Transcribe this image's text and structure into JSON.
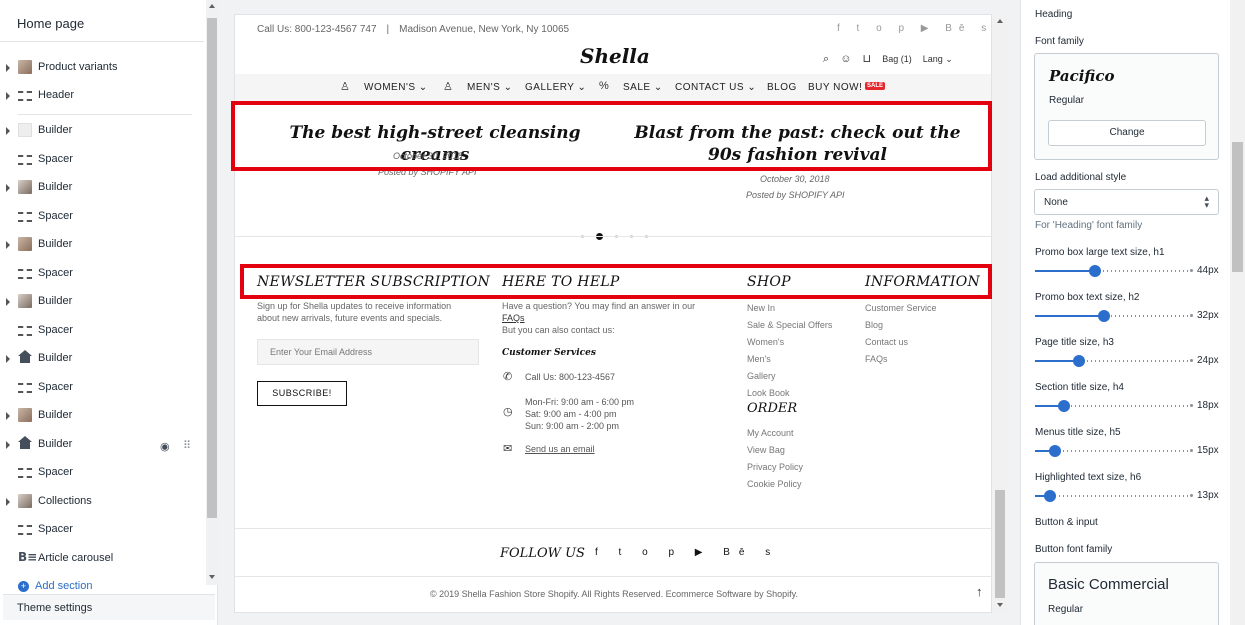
{
  "left_sidebar": {
    "title": "Home page",
    "sections": [
      {
        "label": "Product variants"
      },
      {
        "label": "Header"
      },
      {
        "label": "Builder"
      },
      {
        "label": "Spacer"
      },
      {
        "label": "Builder"
      },
      {
        "label": "Spacer"
      },
      {
        "label": "Builder"
      },
      {
        "label": "Spacer"
      },
      {
        "label": "Builder"
      },
      {
        "label": "Spacer"
      },
      {
        "label": "Builder"
      },
      {
        "label": "Spacer"
      },
      {
        "label": "Builder"
      },
      {
        "label": "Builder"
      },
      {
        "label": "Spacer"
      },
      {
        "label": "Collections"
      },
      {
        "label": "Spacer"
      },
      {
        "label": "Article carousel"
      }
    ],
    "add_section": "Add section",
    "theme_settings": "Theme settings"
  },
  "preview": {
    "topbar": {
      "contact": "Call Us: 800-123-4567 747",
      "separator": "|",
      "address": "Madison Avenue, New York, Ny 10065",
      "social_glyphs": "f t o p ▶ Bē s"
    },
    "logo": "Shella",
    "header": {
      "bag": "Bag (1)",
      "lang": "Lang ⌄"
    },
    "nav": {
      "items": [
        "WOMEN'S ⌄",
        "MEN'S ⌄",
        "GALLERY ⌄",
        "SALE ⌄",
        "CONTACT US ⌄",
        "BLOG",
        "BUY NOW!"
      ],
      "sale_badge": "SALE"
    },
    "blog": [
      {
        "title": "The best high-street cleansing creams",
        "date": "October 30, 2018",
        "by": "Posted by SHOPIFY API"
      },
      {
        "title": "Blast from the past: check out the 90s fashion revival",
        "date": "October 30, 2018",
        "by": "Posted by SHOPIFY API"
      }
    ],
    "footer": {
      "newsletter": {
        "heading": "NEWSLETTER SUBSCRIPTION",
        "text1": "Sign up for Shella updates to receive information",
        "text2": "about new arrivals, future events and specials.",
        "placeholder": "Enter Your Email Address",
        "button": "SUBSCRIBE!"
      },
      "help": {
        "heading": "HERE TO HELP",
        "line1": "Have a question? You may find an answer in our",
        "faqs": "FAQs",
        "dot": ".",
        "line2": "But you can also contact us:",
        "customer_services": "Customer Services",
        "call": "Call Us: 800-123-4567",
        "hours1": "Mon-Fri: 9:00 am - 6:00 pm",
        "hours2": "Sat: 9:00 am - 4:00 pm",
        "hours3": "Sun: 9:00 am - 2:00 pm",
        "email": "Send us an email"
      },
      "shop": {
        "heading": "SHOP",
        "links": [
          "New In",
          "Sale & Special Offers",
          "Women's",
          "Men's",
          "Gallery",
          "Look Book"
        ]
      },
      "order": {
        "heading": "ORDER",
        "links": [
          "My Account",
          "View Bag",
          "Privacy Policy",
          "Cookie Policy"
        ]
      },
      "information": {
        "heading": "INFORMATION",
        "links": [
          "Customer Service",
          "Blog",
          "Contact us",
          "FAQs"
        ]
      },
      "follow": "FOLLOW US",
      "social_glyphs": "f t o p ▶ Bē s",
      "copyright": "© 2019 Shella Fashion Store Shopify. All Rights Reserved. Ecommerce Software by Shopify."
    }
  },
  "right_panel": {
    "section_title": "Heading",
    "font_family_label": "Font family",
    "font_name": "Pacifico",
    "font_style": "Regular",
    "change_button": "Change",
    "load_style_label": "Load additional style",
    "load_style_value": "None",
    "load_style_hint": "For 'Heading' font family",
    "sliders": [
      {
        "label": "Promo box large text size, h1",
        "value": "44px",
        "fraction": 0.39
      },
      {
        "label": "Promo box text size, h2",
        "value": "32px",
        "fraction": 0.45
      },
      {
        "label": "Page title size, h3",
        "value": "24px",
        "fraction": 0.29
      },
      {
        "label": "Section title size, h4",
        "value": "18px",
        "fraction": 0.19
      },
      {
        "label": "Menus title size, h5",
        "value": "15px",
        "fraction": 0.13
      },
      {
        "label": "Highlighted text size, h6",
        "value": "13px",
        "fraction": 0.1
      }
    ],
    "button_input_label": "Button & input",
    "button_font_family_label": "Button font family",
    "button_font_name": "Basic Commercial",
    "button_font_style": "Regular"
  },
  "colors": {
    "highlight": "#e3000f",
    "accent": "#2c6ecb",
    "sale": "#e5262b"
  }
}
